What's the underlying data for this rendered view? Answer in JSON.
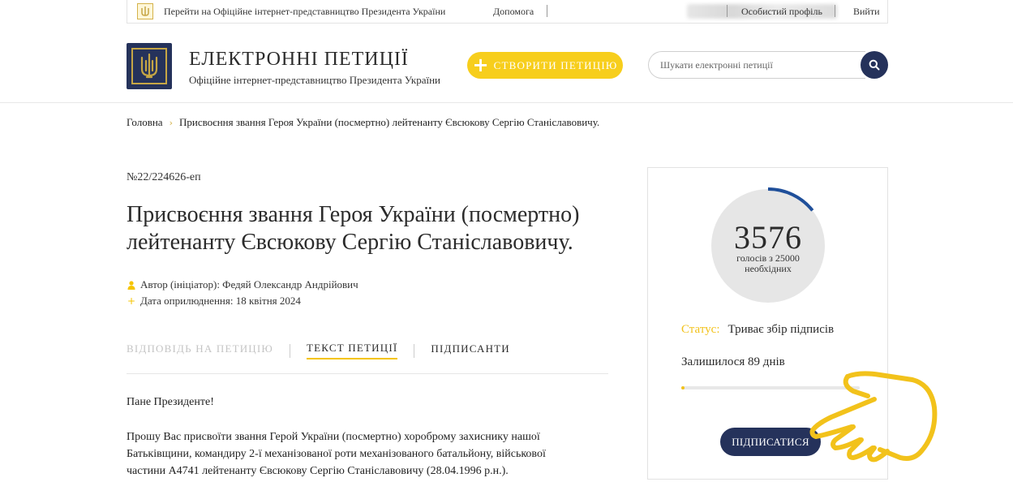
{
  "topbar": {
    "president_link": "Перейти на Офіційне інтернет-представництво Президента України",
    "help": "Допомога",
    "profile": "Особистий профіль",
    "logout": "Вийти"
  },
  "header": {
    "title": "ЕЛЕКТРОННІ ПЕТИЦІЇ",
    "subtitle": "Офіційне інтернет-представництво Президента України",
    "create_button": "СТВОРИТИ ПЕТИЦІЮ",
    "search_placeholder": "Шукати електронні петиції"
  },
  "breadcrumb": {
    "home": "Головна",
    "current": "Присвоєння звання Героя України (посмертно) лейтенанту Євсюкову Сергію Станіславовичу."
  },
  "petition": {
    "number": "№22/224626-еп",
    "title": "Присвоєння звання Героя України (посмертно) лейтенанту Євсюкову Сергію Станіславовичу.",
    "author": "Автор (ініціатор): Федяй Олександр Андрійович",
    "published": "Дата оприлюднення: 18 квітня 2024"
  },
  "tabs": [
    {
      "label": "ВІДПОВІДЬ НА ПЕТИЦІЮ"
    },
    {
      "label": "ТЕКСТ ПЕТИЦІЇ"
    },
    {
      "label": "ПІДПИСАНТИ"
    }
  ],
  "content": {
    "greeting": "Пане Президенте!",
    "lines": [
      "Прошу Вас присвоїти звання Герой України (посмертно) хороброму захиснику нашої",
      "Батьківщини, командиру 2-ї механізованої роти механізованого батальйону, військової",
      "частини А4741 лейтенанту Євсюкову Сергію Станіславовичу (28.04.1996 р.н.)."
    ]
  },
  "votes": {
    "count": "3576",
    "needed_line1": "голосів з 25000",
    "needed_line2": "необхідних",
    "count_value": 3576,
    "target_value": 25000,
    "status_label": "Статус:",
    "status_value": "Триває збір підписів",
    "remaining": "Залишилося 89 днів",
    "sign_button": "ПІДПИСАТИСЯ"
  },
  "colors": {
    "accent_yellow": "#f7ce1c",
    "navy": "#25325b",
    "ring_bg": "#e6e6e6",
    "ring_progress": "#1f4f9a"
  }
}
